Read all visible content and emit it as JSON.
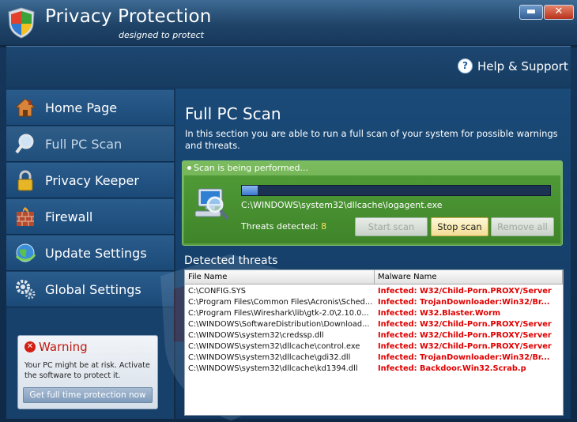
{
  "titlebar": {
    "title": "Privacy Protection",
    "subtitle": "designed to protect",
    "minimize": "▬",
    "close": "✕"
  },
  "header": {
    "help_label": "Help & Support",
    "help_icon": "?"
  },
  "sidebar": {
    "items": [
      {
        "label": "Home Page",
        "icon": "house-icon"
      },
      {
        "label": "Full PC Scan",
        "icon": "magnifier-icon",
        "active": true
      },
      {
        "label": "Privacy Keeper",
        "icon": "padlock-icon"
      },
      {
        "label": "Firewall",
        "icon": "brick-wall-icon"
      },
      {
        "label": "Update Settings",
        "icon": "globe-update-icon"
      },
      {
        "label": "Global Settings",
        "icon": "gears-icon"
      }
    ],
    "warning": {
      "title": "Warning",
      "text": "Your PC might be at risk. Activate the software to protect it.",
      "button": "Get full time protection now"
    }
  },
  "main": {
    "title": "Full PC Scan",
    "description": "In this section you are able to run a full scan of your system for possible warnings and threats.",
    "scan": {
      "status": "Scan is being performed...",
      "progress": 0.05,
      "current_file": "C:\\WINDOWS\\system32\\dllcache\\logagent.exe",
      "threats_label": "Threats detected:",
      "threats_count": "8",
      "start_button": "Start scan",
      "stop_button": "Stop scan",
      "remove_button": "Remove all"
    },
    "detected": {
      "title": "Detected threats",
      "columns": [
        "File Name",
        "Malware Name"
      ],
      "rows": [
        [
          "C:\\CONFIG.SYS",
          "Infected: W32/Child-Porn.PROXY/Server"
        ],
        [
          "C:\\Program Files\\Common Files\\Acronis\\Sched...",
          "Infected: TrojanDownloader:Win32/Br..."
        ],
        [
          "C:\\Program Files\\Wireshark\\lib\\gtk-2.0\\2.10.0...",
          "Infected: W32.Blaster.Worm"
        ],
        [
          "C:\\WINDOWS\\SoftwareDistribution\\Download...",
          "Infected: W32/Child-Porn.PROXY/Server"
        ],
        [
          "C:\\WINDOWS\\system32\\credssp.dll",
          "Infected: W32/Child-Porn.PROXY/Server"
        ],
        [
          "C:\\WINDOWS\\system32\\dllcache\\control.exe",
          "Infected: W32/Child-Porn.PROXY/Server"
        ],
        [
          "C:\\WINDOWS\\system32\\dllcache\\gdi32.dll",
          "Infected: TrojanDownloader:Win32/Br..."
        ],
        [
          "C:\\WINDOWS\\system32\\dllcache\\kd1394.dll",
          "Infected: Backdoor.Win32.Scrab.p"
        ]
      ]
    }
  }
}
